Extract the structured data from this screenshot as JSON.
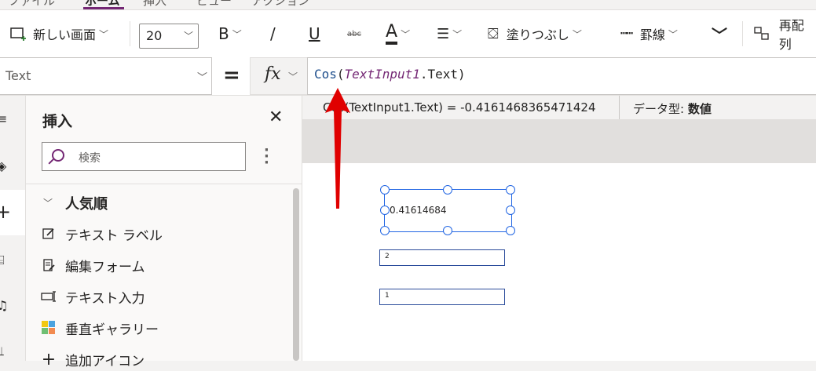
{
  "menu": {
    "tabs": [
      "ファイル",
      "ホーム",
      "挿入",
      "ビュー",
      "アクション"
    ],
    "active_tab": "ホーム"
  },
  "ribbon": {
    "new_screen": "新しい画面",
    "font_size": "20",
    "bold": "B",
    "italic": "/",
    "underline": "U",
    "strikethrough": "abc",
    "font_color": "A",
    "fill": "塗りつぶし",
    "border": "罫線",
    "reorder": "再配列"
  },
  "formula_bar": {
    "property": "Text",
    "equals": "=",
    "fx": "fx",
    "formula_fn": "Cos",
    "formula_open": "(",
    "formula_control": "TextInput1",
    "formula_rest": ".Text)"
  },
  "result": {
    "expression": "Cos(TextInput1.Text)  =  -0.4161468365471424",
    "type_label": "データ型: ",
    "type_value": "数値"
  },
  "insert_pane": {
    "title": "挿入",
    "search_placeholder": "検索",
    "category": "人気順",
    "items": [
      {
        "label": "テキスト ラベル",
        "icon": "edit-label-icon"
      },
      {
        "label": "編集フォーム",
        "icon": "edit-form-icon"
      },
      {
        "label": "テキスト入力",
        "icon": "text-input-icon"
      },
      {
        "label": "垂直ギャラリー",
        "icon": "gallery-icon"
      },
      {
        "label": "追加アイコン",
        "icon": "add-icon"
      }
    ]
  },
  "canvas": {
    "label_value": "0.41614684",
    "input1_value": "2",
    "input2_value": "1"
  },
  "colors": {
    "accent": "#742774",
    "selection": "#2266e3",
    "annotation_arrow": "#e00000"
  }
}
